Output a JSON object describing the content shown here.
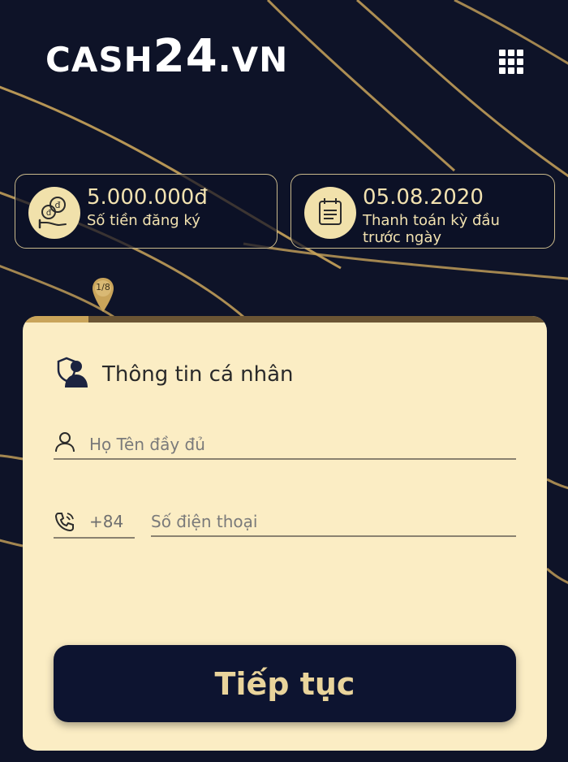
{
  "brand": {
    "logo_part1": "CASH",
    "logo_part2": "24",
    "logo_part3": ".VN"
  },
  "summary_cards": [
    {
      "value": "5.000.000đ",
      "label": "Số tiền đăng ký",
      "icon": "money-bag-hand-icon"
    },
    {
      "value": "05.08.2020",
      "label": "Thanh toán kỳ đầu trước ngày",
      "icon": "calendar-icon"
    }
  ],
  "progress": {
    "step_text": "1/8",
    "fraction": 0.125
  },
  "form": {
    "section_title": "Thông tin cá nhân",
    "section_icon": "user-shield-icon",
    "name_placeholder": "Họ Tên đầy đủ",
    "phone_prefix": "+84",
    "phone_placeholder": "Số điện thoại",
    "submit_label": "Tiếp tục"
  },
  "colors": {
    "background": "#0e1328",
    "gold_line": "#c9a45a",
    "card_bg": "#fbedc4",
    "button_bg": "#0d1430",
    "button_text": "#e9d49b"
  }
}
